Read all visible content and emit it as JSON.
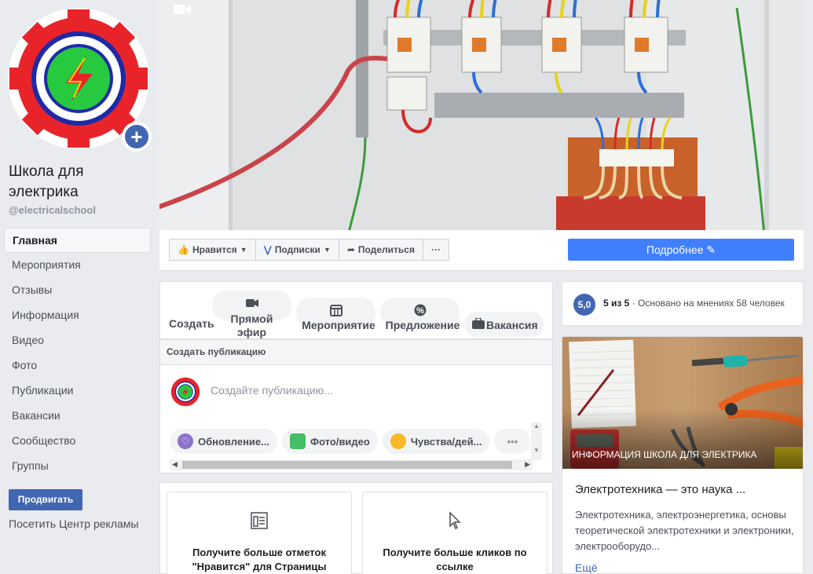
{
  "page": {
    "name": "Школа для электрика",
    "handle": "@electricalschool"
  },
  "sidebar": {
    "items": [
      {
        "label": "Главная"
      },
      {
        "label": "Мероприятия"
      },
      {
        "label": "Отзывы"
      },
      {
        "label": "Информация"
      },
      {
        "label": "Видео"
      },
      {
        "label": "Фото"
      },
      {
        "label": "Публикации"
      },
      {
        "label": "Вакансии"
      },
      {
        "label": "Сообщество"
      },
      {
        "label": "Группы"
      }
    ],
    "promote_label": "Продвигать",
    "ads_center_label": "Посетить Центр рекламы"
  },
  "actions": {
    "like": "Нравится",
    "follow": "Подписки",
    "share": "Поделиться",
    "more": "···",
    "details": "Подробнее"
  },
  "creator": {
    "create": "Создать",
    "live_line1": "Прямой",
    "live_line2": "эфир",
    "event": "Мероприятие",
    "offer": "Предложение",
    "job": "Вакансия"
  },
  "composer": {
    "header": "Создать публикацию",
    "placeholder": "Создайте публикацию...",
    "chips": [
      "Обновление...",
      "Фото/видео",
      "Чувства/дей..."
    ]
  },
  "promo": {
    "likes": "Получите больше отметок \"Нравится\" для Страницы",
    "clicks": "Получите больше кликов по ссылке"
  },
  "rating": {
    "badge": "5,0",
    "score": "5 из 5",
    "text": " · Основано на мнениях 58 человек"
  },
  "info": {
    "caption": "ИНФОРМАЦИЯ ШКОЛА ДЛЯ ЭЛЕКТРИКА",
    "title": "Электротехника — это наука ...",
    "desc": "Электротехника, электроэнергетика, основы теоретической электротехники и электроники, электрооборудо...",
    "more": "Ещё"
  },
  "colors": {
    "accent": "#4267b2",
    "primary_button": "#4080ff",
    "background": "#e9ebee"
  }
}
